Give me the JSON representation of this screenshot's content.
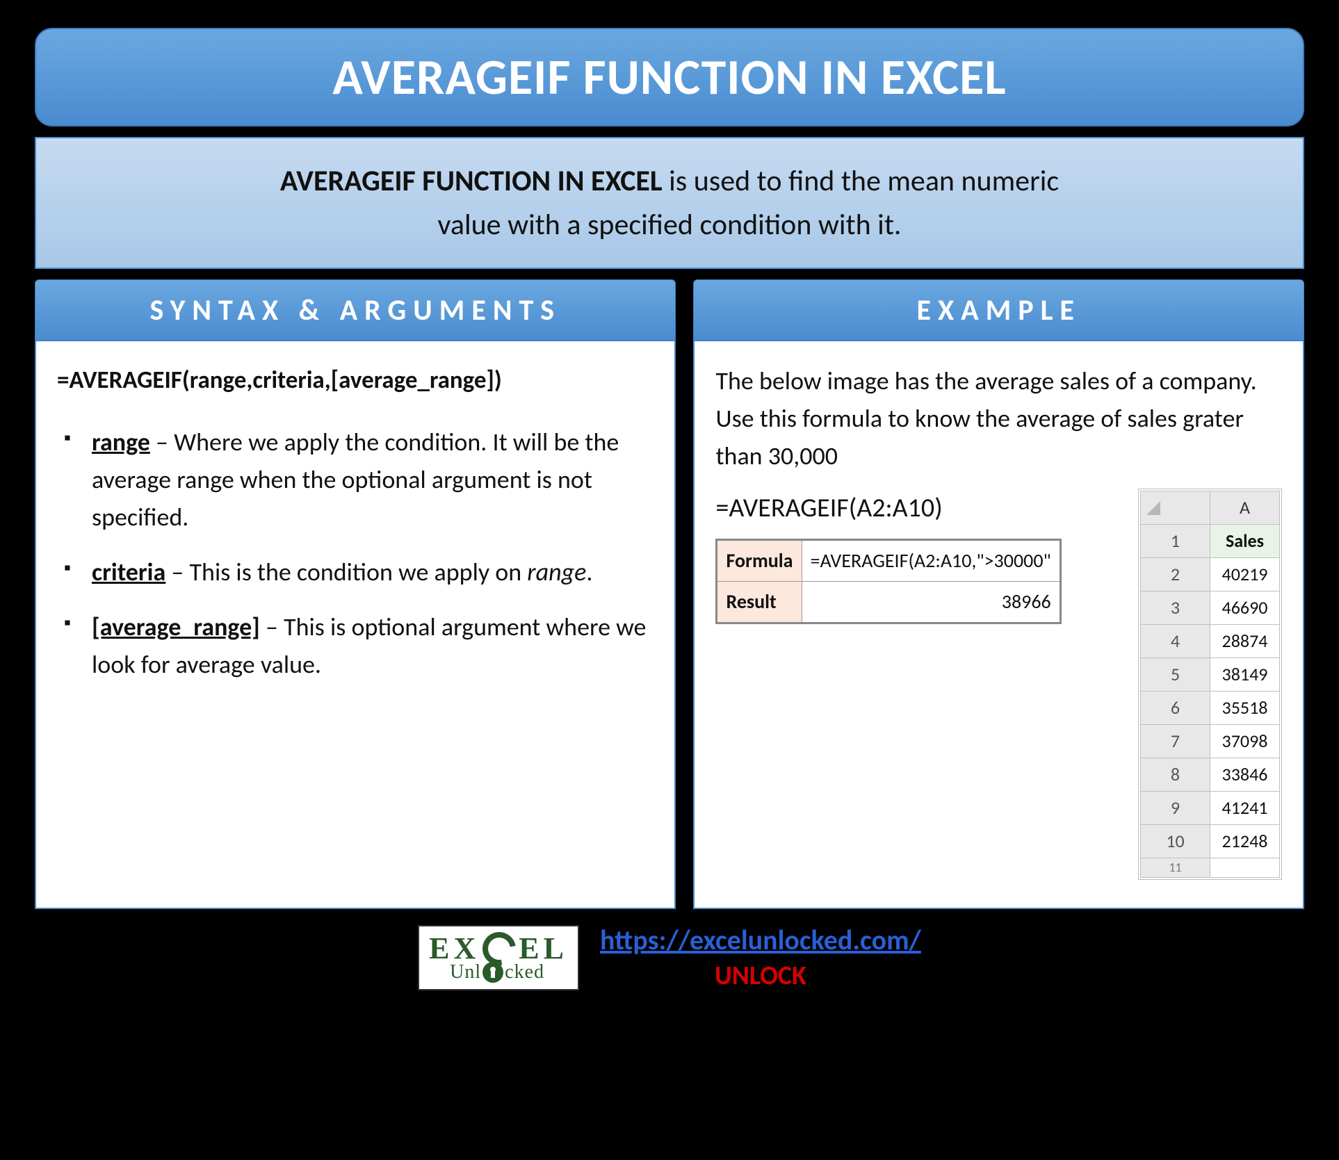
{
  "title": "AVERAGEIF FUNCTION IN EXCEL",
  "description": {
    "bold": "AVERAGEIF FUNCTION IN EXCEL",
    "rest1": " is used to find the mean numeric",
    "rest2": "value with a specified condition with it."
  },
  "syntax": {
    "header": "SYNTAX & ARGUMENTS",
    "formula": "=AVERAGEIF(range,criteria,[average_range])",
    "args": [
      {
        "name": "range",
        "desc": " – Where we apply the condition. It will be the average range when the optional argument is not specified."
      },
      {
        "name": "criteria",
        "desc_pre": " – This is the condition we apply on ",
        "desc_em": "range",
        "desc_post": "."
      },
      {
        "name": "[average_range]",
        "desc": " – This is optional argument where we look for average value."
      }
    ]
  },
  "example": {
    "header": "EXAMPLE",
    "intro": "The below image has the average sales of a company. Use this formula to know the average of sales grater than 30,000",
    "formula_line": "=AVERAGEIF(A2:A10)",
    "table": {
      "formula_label": "Formula",
      "formula_value": "=AVERAGEIF(A2:A10,\">30000\"",
      "result_label": "Result",
      "result_value": "38966"
    },
    "sales": {
      "col_letter": "A",
      "header": "Sales",
      "rows": [
        {
          "n": "1",
          "v": "Sales"
        },
        {
          "n": "2",
          "v": "40219"
        },
        {
          "n": "3",
          "v": "46690"
        },
        {
          "n": "4",
          "v": "28874"
        },
        {
          "n": "5",
          "v": "38149"
        },
        {
          "n": "6",
          "v": "35518"
        },
        {
          "n": "7",
          "v": "37098"
        },
        {
          "n": "8",
          "v": "33846"
        },
        {
          "n": "9",
          "v": "41241"
        },
        {
          "n": "10",
          "v": "21248"
        }
      ]
    }
  },
  "footer": {
    "logo_top": "EX",
    "logo_top2": "EL",
    "logo_bottom_pre": "Unl",
    "logo_bottom_post": "cked",
    "url": "https://excelunlocked.com/",
    "unlock": "UNLOCK"
  }
}
